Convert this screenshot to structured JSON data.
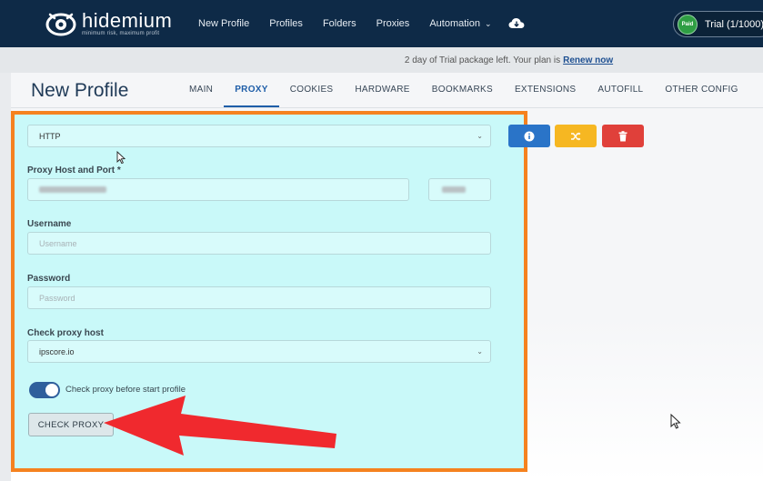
{
  "brand": {
    "name": "hidemium",
    "tagline": "minimum risk, maximum profit"
  },
  "nav": {
    "items": [
      "New Profile",
      "Profiles",
      "Folders",
      "Proxies",
      "Automation"
    ],
    "automation_caret": "⌄",
    "download_icon": "cloud-download-icon"
  },
  "plan": {
    "badge": "Paid",
    "text": "Trial (1/1000)"
  },
  "notice": {
    "text": "2 day of Trial package left. Your plan is",
    "link": "Renew now"
  },
  "page": {
    "title": "New Profile"
  },
  "tabs": [
    {
      "label": "MAIN",
      "active": false
    },
    {
      "label": "PROXY",
      "active": true
    },
    {
      "label": "COOKIES",
      "active": false
    },
    {
      "label": "HARDWARE",
      "active": false
    },
    {
      "label": "BOOKMARKS",
      "active": false
    },
    {
      "label": "EXTENSIONS",
      "active": false
    },
    {
      "label": "AUTOFILL",
      "active": false
    },
    {
      "label": "OTHER CONFIG",
      "active": false
    }
  ],
  "form": {
    "proxy_type": {
      "value": "HTTP"
    },
    "proxy_host": {
      "label": "Proxy Host and Port *"
    },
    "username": {
      "label": "Username",
      "placeholder": "Username"
    },
    "password": {
      "label": "Password",
      "placeholder": "Password"
    },
    "check_host": {
      "label": "Check proxy host",
      "value": "ipscore.io"
    },
    "toggle": {
      "label": "Check proxy before start profile",
      "on": true
    },
    "check_button": "CHECK PROXY"
  },
  "actions": [
    {
      "name": "info",
      "icon": "info-icon",
      "color": "#2a74c8"
    },
    {
      "name": "shuffle",
      "icon": "shuffle-icon",
      "color": "#f6b722"
    },
    {
      "name": "delete",
      "icon": "trash-icon",
      "color": "#e0403a"
    }
  ],
  "colors": {
    "topbar": "#0e2a47",
    "highlight_frame": "#f5821f",
    "form_bg": "#c9f9f9",
    "arrow": "#f0292e",
    "active_tab": "#1f5ea8"
  }
}
